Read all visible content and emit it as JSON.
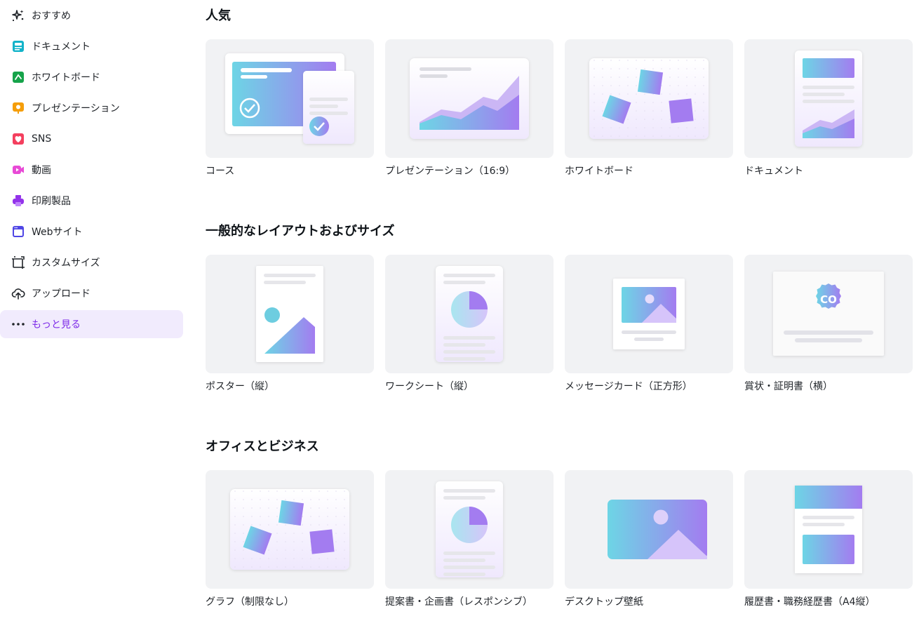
{
  "sidebar": {
    "items": [
      {
        "label": "おすすめ",
        "icon": "sparkle-icon",
        "active": false
      },
      {
        "label": "ドキュメント",
        "icon": "document-icon",
        "active": false
      },
      {
        "label": "ホワイトボード",
        "icon": "whiteboard-icon",
        "active": false
      },
      {
        "label": "プレゼンテーション",
        "icon": "presentation-icon",
        "active": false
      },
      {
        "label": "SNS",
        "icon": "heart-icon",
        "active": false
      },
      {
        "label": "動画",
        "icon": "video-icon",
        "active": false
      },
      {
        "label": "印刷製品",
        "icon": "printer-icon",
        "active": false
      },
      {
        "label": "Webサイト",
        "icon": "website-icon",
        "active": false
      },
      {
        "label": "カスタムサイズ",
        "icon": "custom-size-icon",
        "active": false
      },
      {
        "label": "アップロード",
        "icon": "upload-cloud-icon",
        "active": false
      },
      {
        "label": "もっと見る",
        "icon": "more-dots-icon",
        "active": true
      }
    ]
  },
  "sections": [
    {
      "title": "人気",
      "cards": [
        {
          "label": "コース",
          "art": "course"
        },
        {
          "label": "プレゼンテーション（16:9）",
          "art": "presentation"
        },
        {
          "label": "ホワイトボード",
          "art": "whiteboard"
        },
        {
          "label": "ドキュメント",
          "art": "document"
        }
      ]
    },
    {
      "title": "一般的なレイアウトおよびサイズ",
      "cards": [
        {
          "label": "ポスター（縦）",
          "art": "poster"
        },
        {
          "label": "ワークシート（縦）",
          "art": "worksheet"
        },
        {
          "label": "メッセージカード（正方形）",
          "art": "card"
        },
        {
          "label": "賞状・証明書（横）",
          "art": "certificate",
          "badge_text": "CO"
        }
      ]
    },
    {
      "title": "オフィスとビジネス",
      "cards": [
        {
          "label": "グラフ（制限なし）",
          "art": "whiteboard"
        },
        {
          "label": "提案書・企画書（レスポンシブ）",
          "art": "worksheet"
        },
        {
          "label": "デスクトップ壁紙",
          "art": "wallpaper"
        },
        {
          "label": "履歴書・職務経歴書（A4縦）",
          "art": "resume"
        }
      ]
    }
  ],
  "colors": {
    "active_bg": "#f1ebfd",
    "active_text": "#7d2ae8",
    "thumb_bg": "#f1f2f4",
    "gradient_start": "#6dd5e5",
    "gradient_end": "#a37cf0"
  }
}
